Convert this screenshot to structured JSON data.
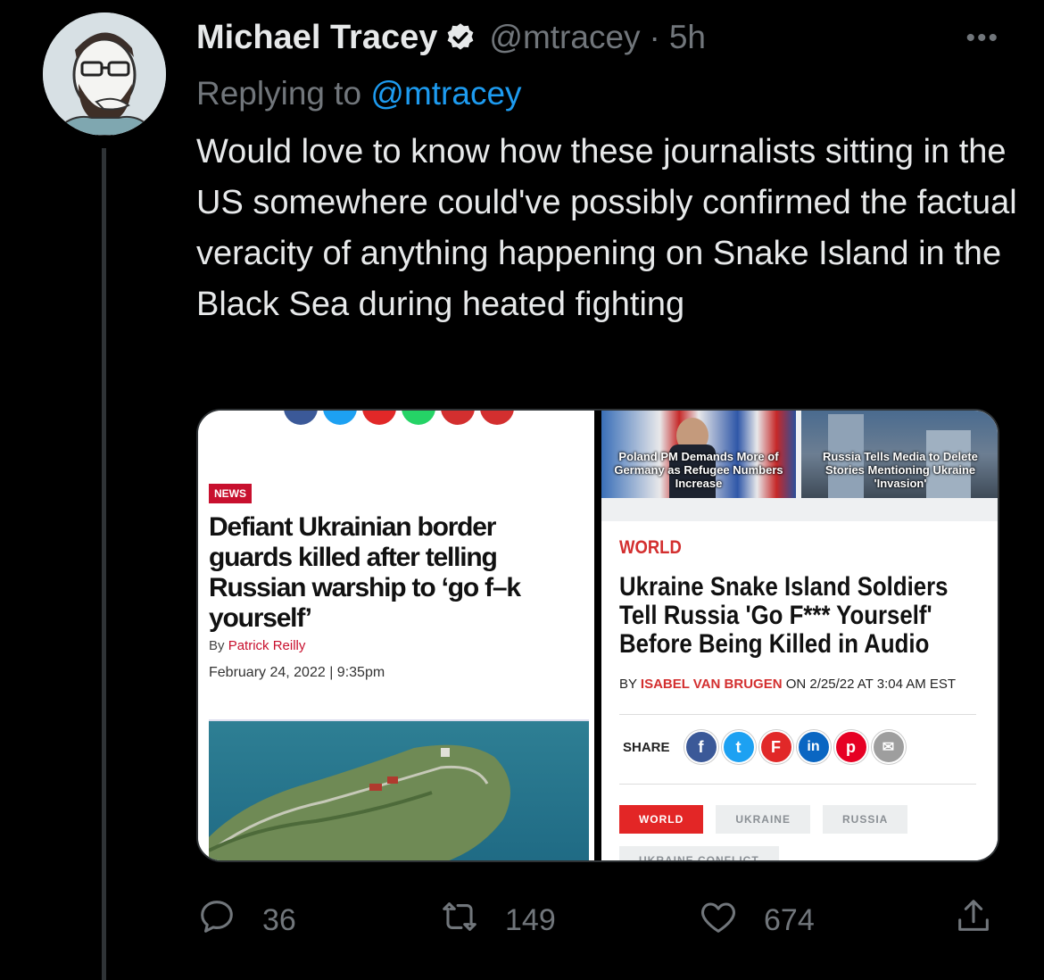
{
  "tweet": {
    "author_name": "Michael Tracey",
    "handle": "@mtracey",
    "separator": "·",
    "time": "5h",
    "replying_prefix": "Replying to",
    "replying_mention": "@mtracey",
    "text": "Would love to know how these journalists sitting in the US somewhere could've possibly confirmed the factual veracity of anything happening on Snake Island in the Black Sea during heated fighting",
    "more_icon": "more-icon",
    "verified_icon": "verified-badge-icon"
  },
  "media": {
    "left": {
      "tag": "NEWS",
      "headline": "Defiant Ukrainian border guards killed after telling Russian warship to ‘go f–k yourself’",
      "byline_prefix": "By",
      "author": "Patrick Reilly",
      "date": "February 24, 2022 | 9:35pm"
    },
    "right": {
      "thumb1_caption": "Poland PM Demands More of Germany as Refugee Numbers Increase",
      "thumb2_caption": "Russia Tells Media to Delete Stories Mentioning Ukraine 'Invasion'",
      "section": "WORLD",
      "headline": "Ukraine Snake Island Soldiers Tell Russia 'Go F*** Yourself' Before Being Killed in Audio",
      "byline_prefix": "BY",
      "author": "ISABEL VAN BRUGEN",
      "byline_suffix": "ON 2/25/22 AT 3:04 AM EST",
      "share_label": "SHARE",
      "share_buttons": [
        {
          "label": "f",
          "color": "#3b5998",
          "icon": "facebook-icon"
        },
        {
          "label": "t",
          "color": "#1da1f2",
          "icon": "twitter-icon"
        },
        {
          "label": "F",
          "color": "#e12828",
          "icon": "flipboard-icon"
        },
        {
          "label": "in",
          "color": "#0a66c2",
          "icon": "linkedin-icon"
        },
        {
          "label": "p",
          "color": "#e60023",
          "icon": "pinterest-icon"
        },
        {
          "label": "✉",
          "color": "#9e9e9e",
          "icon": "email-icon"
        }
      ],
      "tags": [
        "WORLD",
        "UKRAINE",
        "RUSSIA",
        "UKRAINE CONFLICT"
      ]
    }
  },
  "actions": {
    "replies": "36",
    "retweets": "149",
    "likes": "674"
  }
}
